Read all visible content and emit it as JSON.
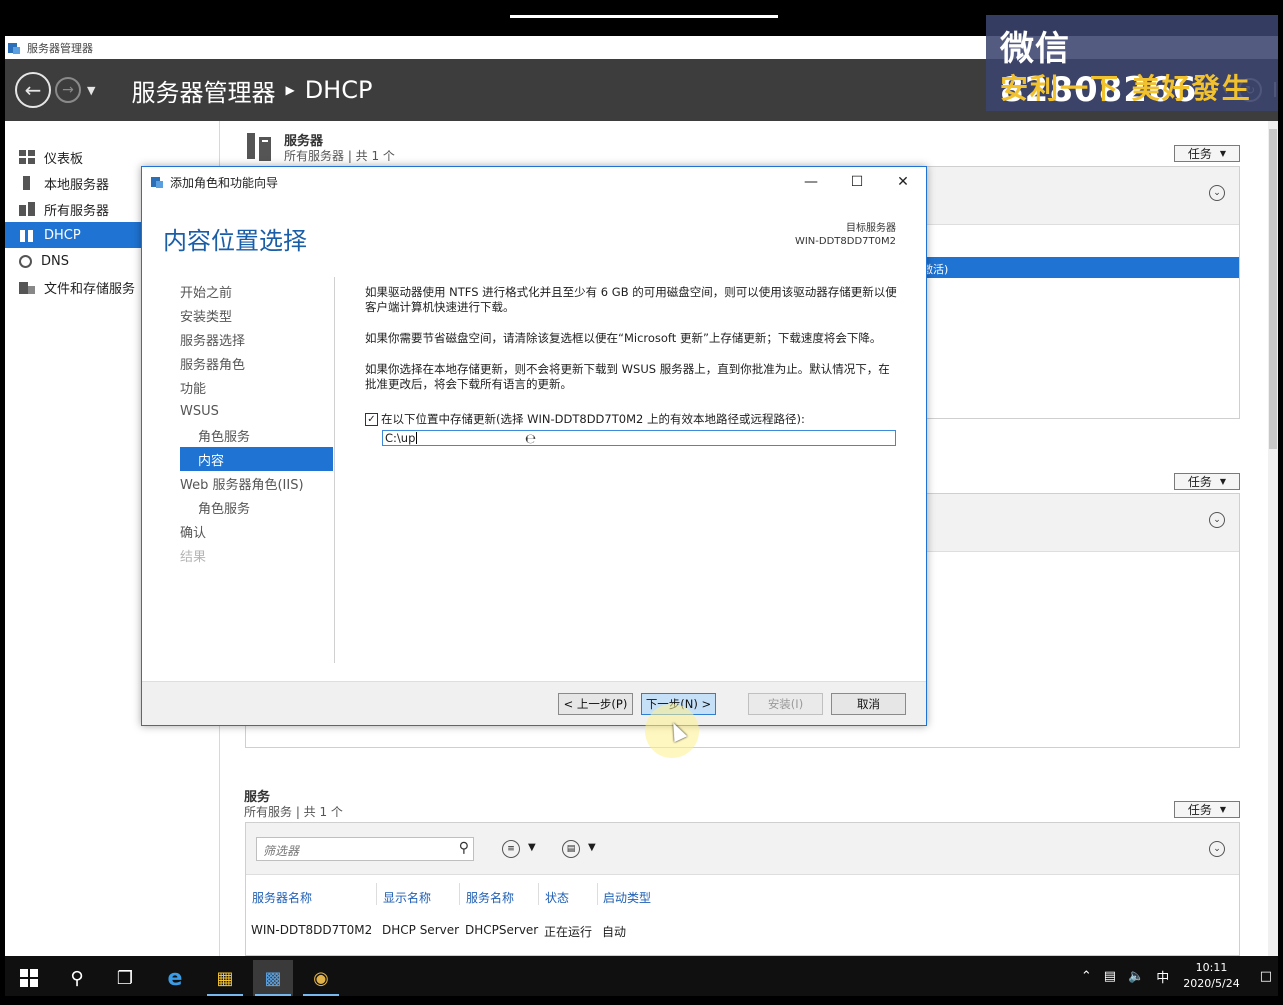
{
  "app": {
    "window_title": "服务器管理器",
    "breadcrumb_root": "服务器管理器",
    "breadcrumb_current": "DHCP",
    "header_menu_fragment": "I"
  },
  "sidebar": {
    "items": [
      {
        "label": "仪表板",
        "icon": "dashboard-icon"
      },
      {
        "label": "本地服务器",
        "icon": "local-server-icon"
      },
      {
        "label": "所有服务器",
        "icon": "all-servers-icon"
      },
      {
        "label": "DHCP",
        "icon": "dhcp-icon"
      },
      {
        "label": "DNS",
        "icon": "dns-icon"
      },
      {
        "label": "文件和存储服务",
        "icon": "file-storage-icon"
      }
    ]
  },
  "main": {
    "servers_title": "服务器",
    "servers_sub": "所有服务器 | 共 1 个",
    "tasks_label": "任务",
    "highlight_row_fragment": "激活)",
    "services_title": "服务",
    "services_sub": "所有服务 | 共 1 个",
    "filter_placeholder": "筛选器",
    "columns": [
      "服务器名称",
      "显示名称",
      "服务名称",
      "状态",
      "启动类型"
    ],
    "row": [
      "WIN-DDT8DD7T0M2",
      "DHCP Server",
      "DHCPServer",
      "正在运行",
      "自动"
    ]
  },
  "wizard": {
    "title": "添加角色和功能向导",
    "heading": "内容位置选择",
    "dest_label": "目标服务器",
    "dest_server": "WIN-DDT8DD7T0M2",
    "nav": [
      {
        "label": "开始之前",
        "state": "normal",
        "sub": false
      },
      {
        "label": "安装类型",
        "state": "normal",
        "sub": false
      },
      {
        "label": "服务器选择",
        "state": "normal",
        "sub": false
      },
      {
        "label": "服务器角色",
        "state": "normal",
        "sub": false
      },
      {
        "label": "功能",
        "state": "normal",
        "sub": false
      },
      {
        "label": "WSUS",
        "state": "normal",
        "sub": false
      },
      {
        "label": "角色服务",
        "state": "normal",
        "sub": true
      },
      {
        "label": "内容",
        "state": "selected",
        "sub": true
      },
      {
        "label": "Web 服务器角色(IIS)",
        "state": "normal",
        "sub": false
      },
      {
        "label": "角色服务",
        "state": "normal",
        "sub": true
      },
      {
        "label": "确认",
        "state": "normal",
        "sub": false
      },
      {
        "label": "结果",
        "state": "disabled",
        "sub": false
      }
    ],
    "para1": "如果驱动器使用 NTFS 进行格式化并且至少有 6 GB 的可用磁盘空间，则可以使用该驱动器存储更新以便客户端计算机快速进行下载。",
    "para2": "如果你需要节省磁盘空间，请清除该复选框以便在“Microsoft 更新”上存储更新；下载速度将会下降。",
    "para3": "如果你选择在本地存储更新，则不会将更新下载到 WSUS 服务器上，直到你批准为止。默认情况下，在批准更改后，将会下载所有语言的更新。",
    "checkbox_label": "在以下位置中存储更新(选择 WIN-DDT8DD7T0M2 上的有效本地路径或远程路径):",
    "checkbox_checked": true,
    "path_value": "C:\\up",
    "buttons": {
      "prev": "< 上一步(P)",
      "next": "下一步(N) >",
      "install": "安装(I)",
      "cancel": "取消"
    }
  },
  "watermark": {
    "line1": "微信 82808266",
    "line2": "安利一下 美好發生"
  },
  "taskbar": {
    "ime": "中",
    "time": "10:11",
    "date": "2020/5/24"
  },
  "colors": {
    "accent": "#1f73d2",
    "header_bg": "#3d3d3d",
    "heading_blue": "#1a5ea8",
    "watermark_gold": "#f2c12e"
  }
}
